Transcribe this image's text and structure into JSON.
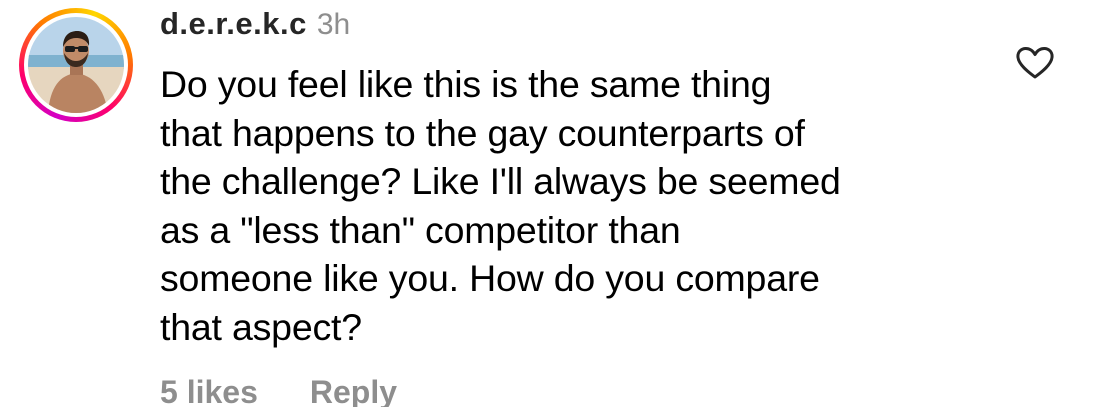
{
  "comment": {
    "username": "d.e.r.e.k.c",
    "time_ago": "3h",
    "text_lines": [
      "Do you feel like this is the same thing",
      "that happens to the gay counterparts of",
      "the challenge? Like I'll always be seemed",
      "as a \"less than\" competitor than",
      "someone like you. How do you compare",
      "that aspect?"
    ],
    "likes_label": "5 likes",
    "reply_label": "Reply",
    "like_icon": "heart-outline-icon",
    "story_ring_colors": [
      "#d300c5",
      "#ff0069",
      "#ff7a00",
      "#ffd600"
    ]
  }
}
